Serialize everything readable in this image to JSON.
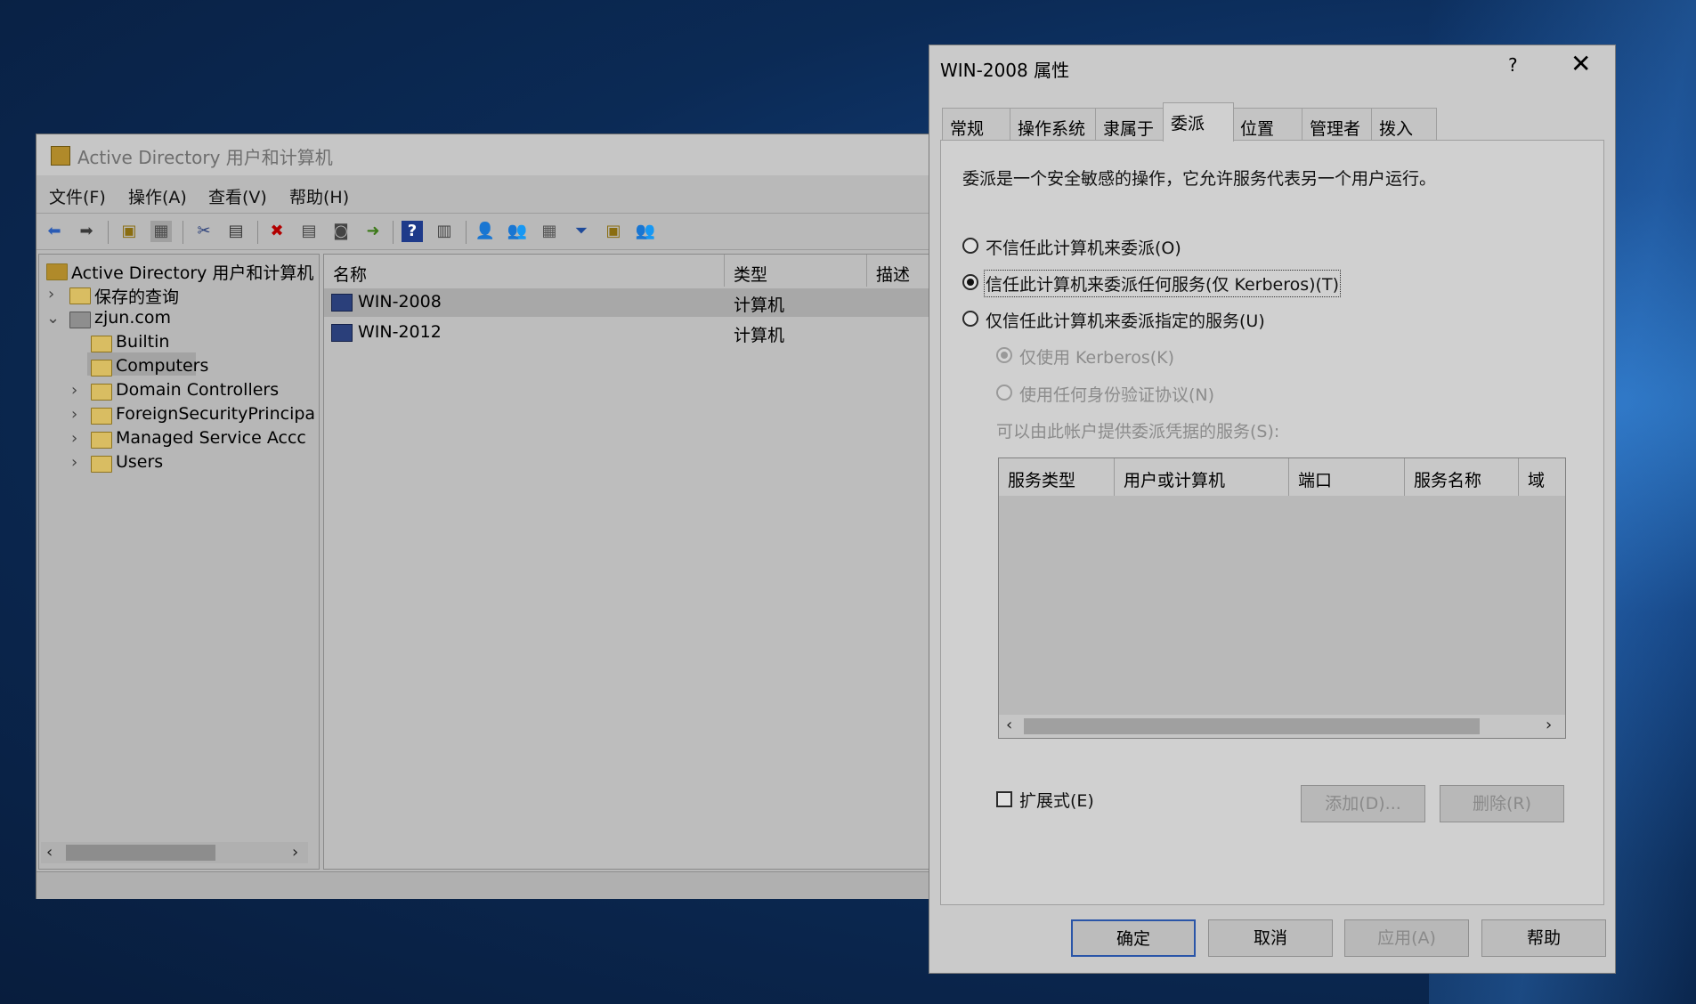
{
  "main_window": {
    "title": "Active Directory 用户和计算机",
    "menu": [
      "文件(F)",
      "操作(A)",
      "查看(V)",
      "帮助(H)"
    ],
    "tree": {
      "root": "Active Directory 用户和计算机",
      "saved_queries": "保存的查询",
      "domain": "zjun.com",
      "children": [
        "Builtin",
        "Computers",
        "Domain Controllers",
        "ForeignSecurityPrincipa",
        "Managed Service Accc",
        "Users"
      ],
      "selected": "Computers"
    },
    "columns": [
      "名称",
      "类型",
      "描述"
    ],
    "rows": [
      {
        "name": "WIN-2008",
        "type": "计算机"
      },
      {
        "name": "WIN-2012",
        "type": "计算机"
      }
    ]
  },
  "dialog": {
    "title": "WIN-2008 属性",
    "help_symbol": "?",
    "close_symbol": "✕",
    "tabs": [
      "常规",
      "操作系统",
      "隶属于",
      "委派",
      "位置",
      "管理者",
      "拨入"
    ],
    "active_tab": "委派",
    "description": "委派是一个安全敏感的操作，它允许服务代表另一个用户运行。",
    "options": [
      "不信任此计算机来委派(O)",
      "信任此计算机来委派任何服务(仅 Kerberos)(T)",
      "仅信任此计算机来委派指定的服务(U)"
    ],
    "sub_options": [
      "仅使用 Kerberos(K)",
      "使用任何身份验证协议(N)"
    ],
    "services_label": "可以由此帐户提供委派凭据的服务(S):",
    "service_columns": [
      "服务类型",
      "用户或计算机",
      "端口",
      "服务名称",
      "域"
    ],
    "expanded_label": "扩展式(E)",
    "add_button": "添加(D)...",
    "remove_button": "删除(R)",
    "ok_button": "确定",
    "cancel_button": "取消",
    "apply_button": "应用(A)",
    "help_button": "帮助"
  }
}
